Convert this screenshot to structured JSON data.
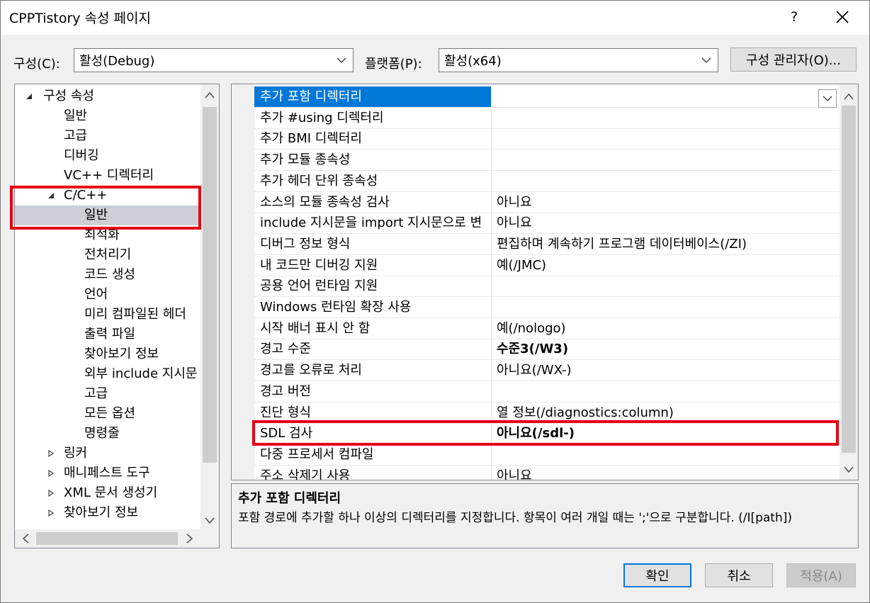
{
  "window": {
    "title": "CPPTistory 속성 페이지",
    "help_label": "?"
  },
  "toolbar": {
    "config_label": "구성(C):",
    "config_value": "활성(Debug)",
    "platform_label": "플랫폼(P):",
    "platform_value": "활성(x64)",
    "config_manager_label": "구성 관리자(O)..."
  },
  "tree": {
    "items": [
      {
        "label": "구성 속성",
        "expanded": true
      },
      {
        "label": "일반"
      },
      {
        "label": "고급"
      },
      {
        "label": "디버깅"
      },
      {
        "label": "VC++ 디렉터리"
      },
      {
        "label": "C/C++",
        "expanded": true
      },
      {
        "label": "일반",
        "selected": true
      },
      {
        "label": "최적화"
      },
      {
        "label": "전처리기"
      },
      {
        "label": "코드 생성"
      },
      {
        "label": "언어"
      },
      {
        "label": "미리 컴파일된 헤더"
      },
      {
        "label": "출력 파일"
      },
      {
        "label": "찾아보기 정보"
      },
      {
        "label": "외부 include 지시문"
      },
      {
        "label": "고급"
      },
      {
        "label": "모든 옵션"
      },
      {
        "label": "명령줄"
      },
      {
        "label": "링커",
        "expanded": false
      },
      {
        "label": "매니페스트 도구",
        "expanded": false
      },
      {
        "label": "XML 문서 생성기",
        "expanded": false
      },
      {
        "label": "찾아보기 정보",
        "expanded": false
      }
    ]
  },
  "grid": {
    "rows": [
      {
        "name": "추가 포함 디렉터리",
        "value": "",
        "selected": true
      },
      {
        "name": "추가 #using 디렉터리",
        "value": ""
      },
      {
        "name": "추가 BMI 디렉터리",
        "value": ""
      },
      {
        "name": "추가 모듈 종속성",
        "value": ""
      },
      {
        "name": "추가 헤더 단위 종속성",
        "value": ""
      },
      {
        "name": "소스의 모듈 종속성 검사",
        "value": "아니요"
      },
      {
        "name": "include 지시문을 import 지시문으로 변",
        "value": "아니요"
      },
      {
        "name": "디버그 정보 형식",
        "value": "편집하며 계속하기 프로그램 데이터베이스(/ZI)"
      },
      {
        "name": "내 코드만 디버깅 지원",
        "value": "예(/JMC)"
      },
      {
        "name": "공용 언어 런타임 지원",
        "value": ""
      },
      {
        "name": "Windows 런타임 확장 사용",
        "value": ""
      },
      {
        "name": "시작 배너 표시 안 함",
        "value": "예(/nologo)"
      },
      {
        "name": "경고 수준",
        "value": "수준3(/W3)",
        "bold": true
      },
      {
        "name": "경고를 오류로 처리",
        "value": "아니요(/WX-)"
      },
      {
        "name": "경고 버전",
        "value": ""
      },
      {
        "name": "진단 형식",
        "value": "열 정보(/diagnostics:column)"
      },
      {
        "name": "SDL 검사",
        "value": "아니요(/sdl-)",
        "bold": true
      },
      {
        "name": "다중 프로세서 컴파일",
        "value": ""
      },
      {
        "name": "주소 삭제기 사용",
        "value": "아니요"
      }
    ]
  },
  "description": {
    "title": "추가 포함 디렉터리",
    "text": "포함 경로에 추가할 하나 이상의 디렉터리를 지정합니다. 항목이 여러 개일 때는 ';'으로 구분합니다. (/I[path])"
  },
  "buttons": {
    "ok": "확인",
    "cancel": "취소",
    "apply": "적용(A)"
  },
  "colors": {
    "highlight": "#e60012",
    "selection_blue": "#0078d7",
    "tree_selection": "#cccfd6"
  }
}
